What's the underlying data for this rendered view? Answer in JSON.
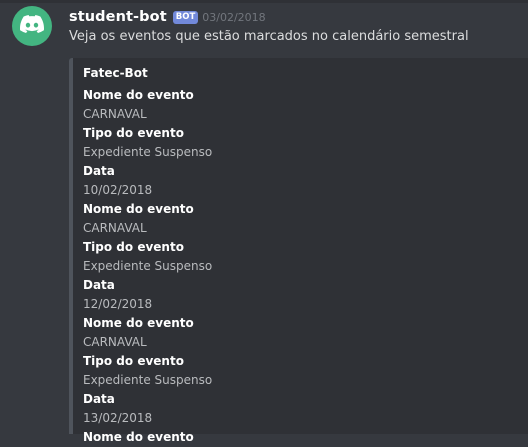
{
  "message": {
    "username": "student-bot",
    "bot_tag": "BOT",
    "timestamp": "03/02/2018",
    "content": "Veja os eventos que estão marcados no calendário semestral",
    "avatar_icon": "discord-logo-icon"
  },
  "embed": {
    "title": "Fatec-Bot",
    "events": [
      {
        "name_label": "Nome do evento",
        "name_value": "CARNAVAL",
        "type_label": "Tipo do evento",
        "type_value": "Expediente Suspenso",
        "date_label": "Data",
        "date_value": "10/02/2018"
      },
      {
        "name_label": "Nome do evento",
        "name_value": "CARNAVAL",
        "type_label": "Tipo do evento",
        "type_value": "Expediente Suspenso",
        "date_label": "Data",
        "date_value": "12/02/2018"
      },
      {
        "name_label": "Nome do evento",
        "name_value": "CARNAVAL",
        "type_label": "Tipo do evento",
        "type_value": "Expediente Suspenso",
        "date_label": "Data",
        "date_value": "13/02/2018"
      },
      {
        "name_label": "Nome do evento"
      }
    ]
  },
  "colors": {
    "background": "#36393f",
    "embed_background": "#2f3136",
    "embed_border": "#4f545c",
    "avatar": "#43b581",
    "bot_tag": "#7289da"
  }
}
